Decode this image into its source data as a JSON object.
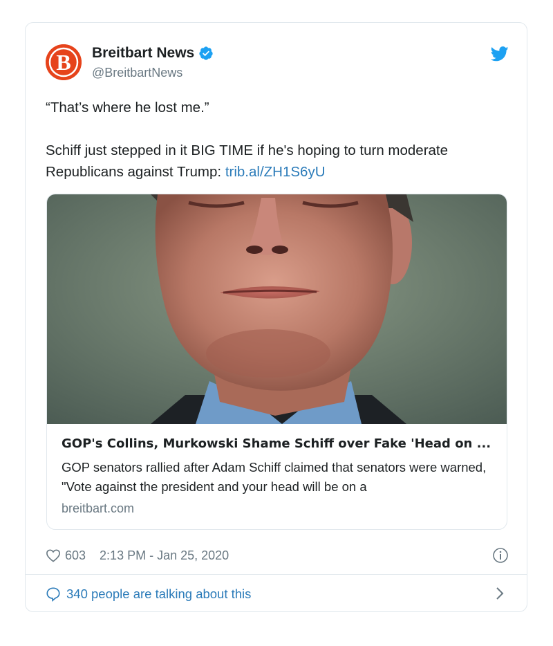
{
  "author": {
    "name": "Breitbart News",
    "handle": "@BreitbartNews",
    "avatar_letter": "B",
    "verified_icon": "verified-badge-icon",
    "brand_color": "#e6431b"
  },
  "platform_icon": "twitter-bird-icon",
  "tweet": {
    "line1": "“That’s where he lost me.”",
    "line2": "Schiff just stepped in it BIG TIME if he's hoping to turn moderate Republicans against Trump: ",
    "link": "trib.al/ZH1S6yU"
  },
  "card": {
    "title": "GOP's Collins, Murkowski Shame Schiff over Fake 'Head on ...",
    "description": "GOP senators rallied after Adam Schiff claimed that senators were warned, \"Vote against the president and your head will be on a",
    "domain": "breitbart.com"
  },
  "meta": {
    "likes": "603",
    "timestamp": "2:13 PM - Jan 25, 2020",
    "info_icon": "info-icon",
    "heart_icon": "heart-icon"
  },
  "footer": {
    "talking": "340 people are talking about this",
    "comment_icon": "comment-bubble-icon",
    "chevron_icon": "chevron-right-icon"
  },
  "colors": {
    "link": "#2b7bb9",
    "secondary_text": "#697882",
    "twitter_blue": "#1da1f2",
    "border": "#e1e8ed"
  }
}
